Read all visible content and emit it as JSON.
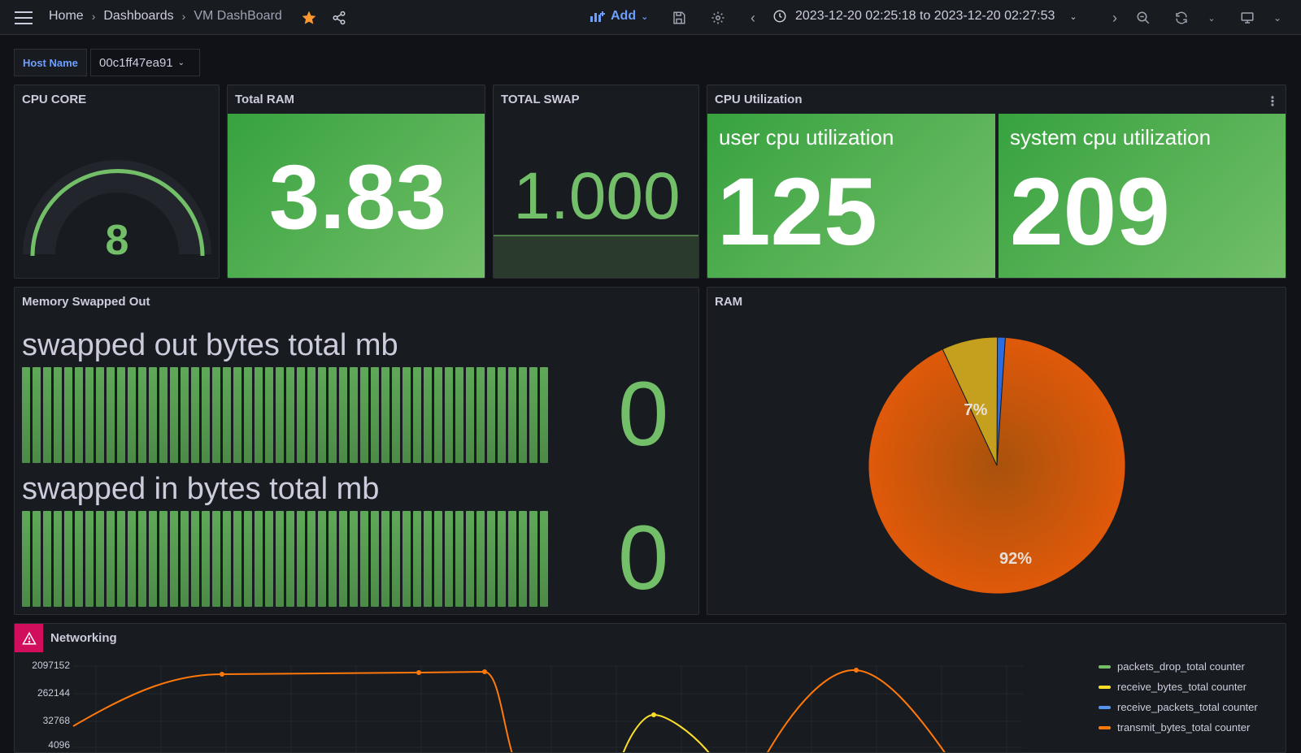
{
  "topbar": {
    "breadcrumbs": [
      "Home",
      "Dashboards",
      "VM DashBoard"
    ],
    "add_label": "Add",
    "time_range": "2023-12-20 02:25:18 to 2023-12-20 02:27:53"
  },
  "variables": {
    "host_label": "Host Name",
    "host_value": "00c1ff47ea91"
  },
  "panels": {
    "cpu_core": {
      "title": "CPU CORE",
      "value": "8",
      "gauge_fraction": 1.0
    },
    "total_ram": {
      "title": "Total RAM",
      "value": "3.83"
    },
    "total_swap": {
      "title": "TOTAL SWAP",
      "value": "1.000"
    },
    "cpu_util": {
      "title": "CPU Utilization",
      "user_label": "user cpu utilization",
      "user_value": "125",
      "system_label": "system cpu utilization",
      "system_value": "209"
    },
    "memory_swapped": {
      "title": "Memory Swapped Out",
      "out_label": "swapped out bytes total mb",
      "out_value": "0",
      "in_label": "swapped in bytes total mb",
      "in_value": "0"
    },
    "ram": {
      "title": "RAM",
      "slice_labels": [
        "92%",
        "7%"
      ]
    },
    "networking": {
      "title": "Networking",
      "y_ticks": [
        "2097152",
        "262144",
        "32768",
        "4096"
      ],
      "legend": [
        {
          "label": "packets_drop_total counter",
          "color": "#73bf69"
        },
        {
          "label": "receive_bytes_total counter",
          "color": "#fade2a"
        },
        {
          "label": "receive_packets_total counter",
          "color": "#5794f2"
        },
        {
          "label": "transmit_bytes_total counter",
          "color": "#ff780a"
        }
      ]
    }
  },
  "colors": {
    "green": "#73bf69",
    "orange": "#ff780a",
    "pie_orange": "#e0590a",
    "pie_yellow": "#c4a01e",
    "pie_blue": "#2b6de0",
    "star": "#ff9830",
    "alert": "#d10e5c"
  },
  "chart_data": {
    "type": "pie",
    "title": "RAM",
    "slices": [
      {
        "label": "92%",
        "value": 92,
        "color": "#e0590a"
      },
      {
        "label": "7%",
        "value": 7,
        "color": "#c4a01e"
      },
      {
        "label": "",
        "value": 1,
        "color": "#2b6de0"
      }
    ]
  }
}
